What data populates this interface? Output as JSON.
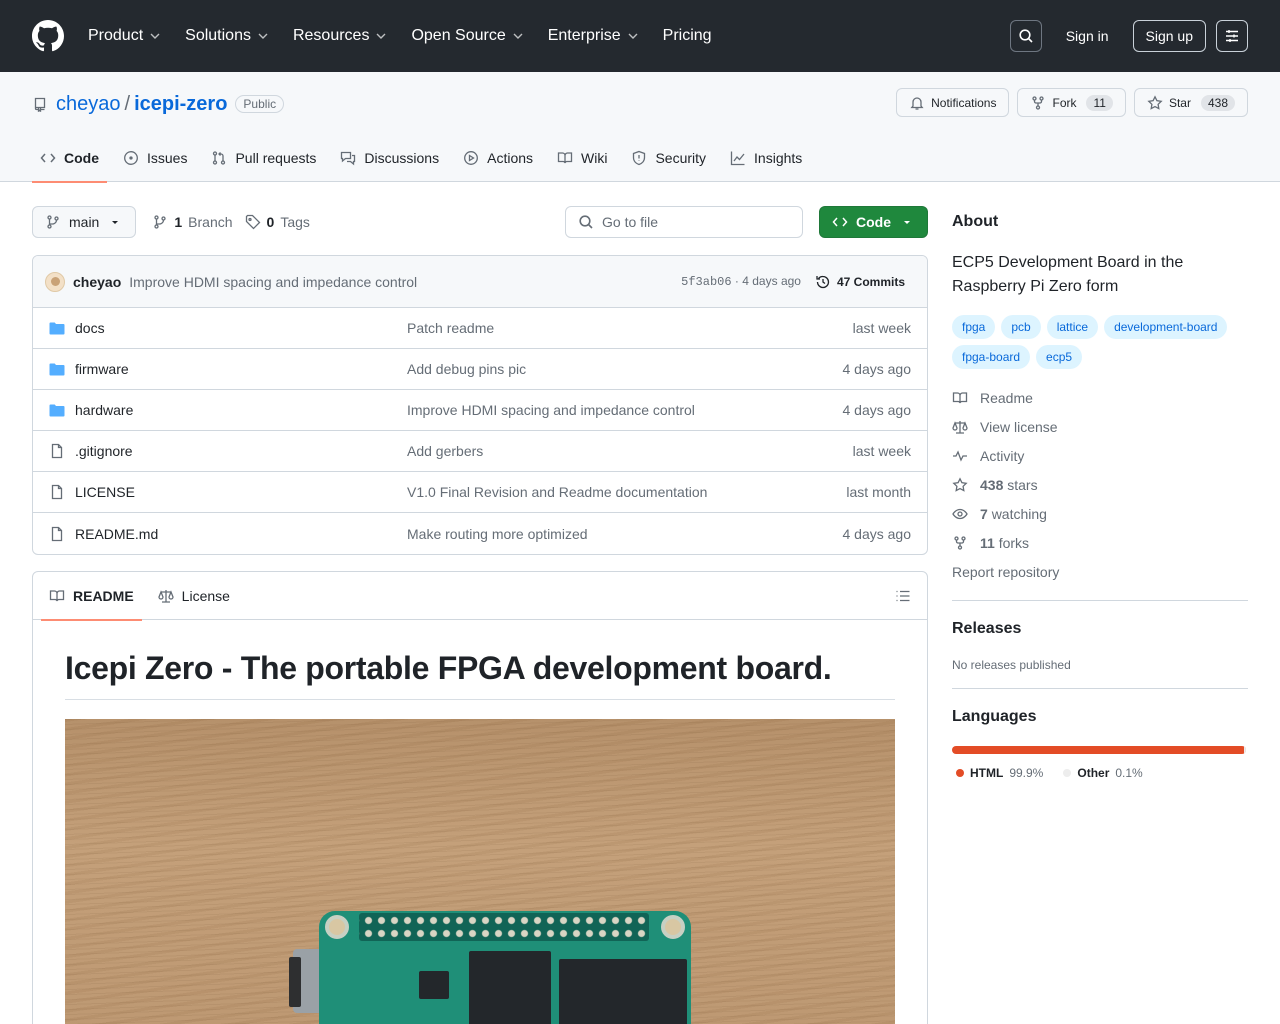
{
  "header": {
    "nav": [
      "Product",
      "Solutions",
      "Resources",
      "Open Source",
      "Enterprise",
      "Pricing"
    ],
    "sign_in": "Sign in",
    "sign_up": "Sign up"
  },
  "repo": {
    "owner": "cheyao",
    "name": "icepi-zero",
    "visibility": "Public",
    "notifications": "Notifications",
    "fork_label": "Fork",
    "fork_count": "11",
    "star_label": "Star",
    "star_count": "438"
  },
  "reponav": [
    "Code",
    "Issues",
    "Pull requests",
    "Discussions",
    "Actions",
    "Wiki",
    "Security",
    "Insights"
  ],
  "toolbar": {
    "branch": "main",
    "branch_count": "1",
    "branch_word": "Branch",
    "tag_count": "0",
    "tag_word": "Tags",
    "go_to_file": "Go to file",
    "code_button": "Code"
  },
  "commit": {
    "author": "cheyao",
    "message": "Improve HDMI spacing and impedance control",
    "hash": "5f3ab06",
    "age": "· 4 days ago",
    "commits": "47 Commits"
  },
  "files": [
    {
      "type": "folder",
      "name": "docs",
      "message": "Patch readme",
      "date": "last week"
    },
    {
      "type": "folder",
      "name": "firmware",
      "message": "Add debug pins pic",
      "date": "4 days ago"
    },
    {
      "type": "folder",
      "name": "hardware",
      "message": "Improve HDMI spacing and impedance control",
      "date": "4 days ago"
    },
    {
      "type": "file",
      "name": ".gitignore",
      "message": "Add gerbers",
      "date": "last week"
    },
    {
      "type": "file",
      "name": "LICENSE",
      "message": "V1.0 Final Revision and Readme documentation",
      "date": "last month"
    },
    {
      "type": "file",
      "name": "README.md",
      "message": "Make routing more optimized",
      "date": "4 days ago"
    }
  ],
  "readme": {
    "tab_readme": "README",
    "tab_license": "License",
    "heading": "Icepi Zero - The portable FPGA development board."
  },
  "about": {
    "title": "About",
    "description": "ECP5 Development Board in the Raspberry Pi Zero form",
    "topics": [
      "fpga",
      "pcb",
      "lattice",
      "development-board",
      "fpga-board",
      "ecp5"
    ],
    "readme": "Readme",
    "license": "View license",
    "activity": "Activity",
    "stars_count": "438",
    "stars_word": "stars",
    "watching_count": "7",
    "watching_word": "watching",
    "forks_count": "11",
    "forks_word": "forks",
    "report": "Report repository"
  },
  "releases": {
    "title": "Releases",
    "none": "No releases published"
  },
  "languages": {
    "title": "Languages",
    "items": [
      {
        "name": "HTML",
        "percent": "99.9%",
        "color": "#e34c26"
      },
      {
        "name": "Other",
        "percent": "0.1%",
        "color": "#ededed"
      }
    ]
  }
}
